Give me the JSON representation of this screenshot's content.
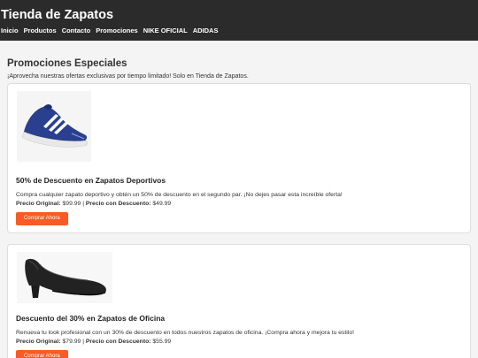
{
  "header": {
    "title": "Tienda de Zapatos",
    "nav": [
      "Inicio",
      "Productos",
      "Contacto",
      "Promociones",
      "NIKE OFICIAL",
      "ADIDAS"
    ]
  },
  "main": {
    "title": "Promociones Especiales",
    "intro": "¡Aprovecha nuestras ofertas exclusivas por tiempo limitado! Solo en Tienda de Zapatos."
  },
  "promos": [
    {
      "image": "blue-running-shoe",
      "title": "50% de Descuento en Zapatos Deportivos",
      "description": "Compra cualquier zapato deportivo y obtén un 50% de descuento en el segundo par. ¡No dejes pasar esta increíble oferta!",
      "original_label": "Precio Original:",
      "original_price": "$99.99",
      "discount_label": "Precio con Descuento:",
      "discount_price": "$49.99",
      "button": "Comprar Ahora"
    },
    {
      "image": "black-office-heel-shoe",
      "title": "Descuento del 30% en Zapatos de Oficina",
      "description": "Renueva tu look profesional con un 30% de descuento en todos nuestros zapatos de oficina. ¡Compra ahora y mejora tu estilo!",
      "original_label": "Precio Original:",
      "original_price": "$79.99",
      "discount_label": "Precio con Descuento:",
      "discount_price": "$55.99",
      "button": "Comprar Ahora"
    }
  ],
  "colors": {
    "header_bg": "#2b2b2b",
    "button": "#fa5a23",
    "shoe_blue": "#2b3f8f"
  }
}
